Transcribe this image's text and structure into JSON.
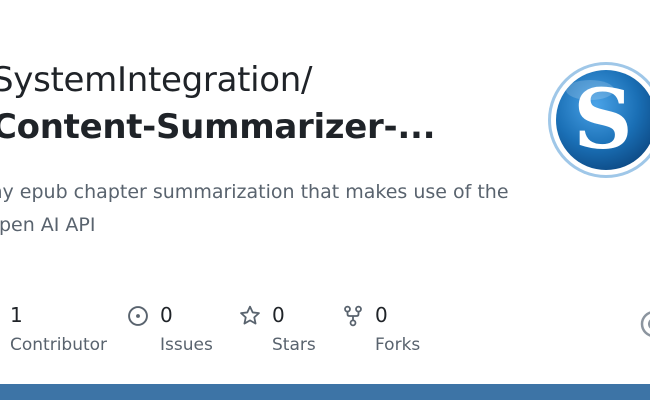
{
  "repo": {
    "owner_path": "SystemIntegration/",
    "name": "Content-Summarizer-...",
    "description": "my epub chapter summarization that makes use of the Open AI API"
  },
  "logo": {
    "letter": "S",
    "color": "#1a6fb5"
  },
  "stats": {
    "contributors": {
      "count": "1",
      "label": "Contributor"
    },
    "issues": {
      "count": "0",
      "label": "Issues",
      "icon": "issue-opened-icon"
    },
    "stars": {
      "count": "0",
      "label": "Stars",
      "icon": "star-icon"
    },
    "forks": {
      "count": "0",
      "label": "Forks",
      "icon": "fork-icon"
    }
  },
  "colors": {
    "bottom_bar": "#3d74a6",
    "muted_text": "#59636e",
    "icon": "#59636e"
  }
}
